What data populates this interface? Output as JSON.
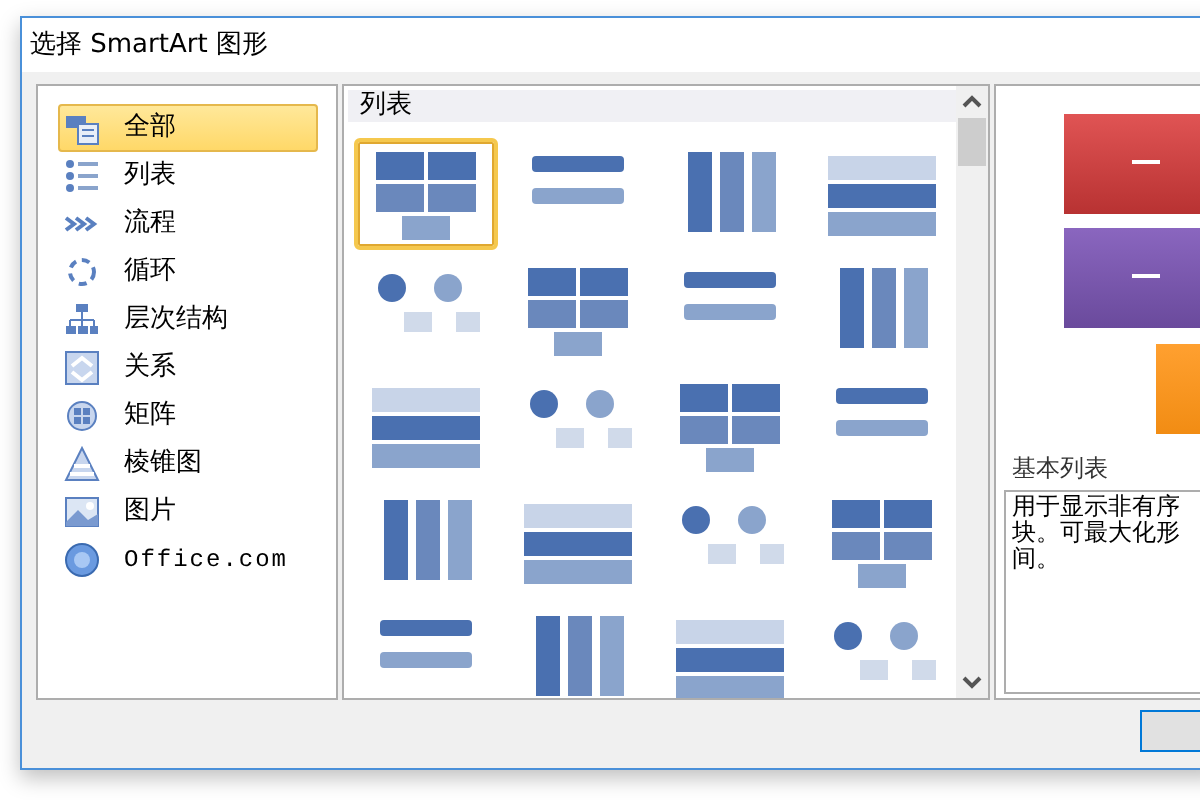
{
  "window": {
    "title": "选择 SmartArt 图形"
  },
  "categories": [
    {
      "label": "全部",
      "selected": true
    },
    {
      "label": "列表",
      "selected": false
    },
    {
      "label": "流程",
      "selected": false
    },
    {
      "label": "循环",
      "selected": false
    },
    {
      "label": "层次结构",
      "selected": false
    },
    {
      "label": "关系",
      "selected": false
    },
    {
      "label": "矩阵",
      "selected": false
    },
    {
      "label": "棱锥图",
      "selected": false
    },
    {
      "label": "图片",
      "selected": false
    },
    {
      "label": "Office.com",
      "selected": false
    }
  ],
  "gallery": {
    "heading": "列表",
    "items": [
      {
        "selected": true
      },
      {
        "selected": false
      },
      {
        "selected": false
      },
      {
        "selected": false
      },
      {
        "selected": false
      },
      {
        "selected": false
      },
      {
        "selected": false
      },
      {
        "selected": false
      },
      {
        "selected": false
      },
      {
        "selected": false
      },
      {
        "selected": false
      },
      {
        "selected": false
      },
      {
        "selected": false
      },
      {
        "selected": false
      },
      {
        "selected": false
      },
      {
        "selected": false
      },
      {
        "selected": false
      },
      {
        "selected": false
      },
      {
        "selected": false
      },
      {
        "selected": false
      }
    ]
  },
  "preview": {
    "name": "基本列表",
    "description": [
      "用于显示非有序",
      "块。可最大化形",
      "间。"
    ]
  }
}
